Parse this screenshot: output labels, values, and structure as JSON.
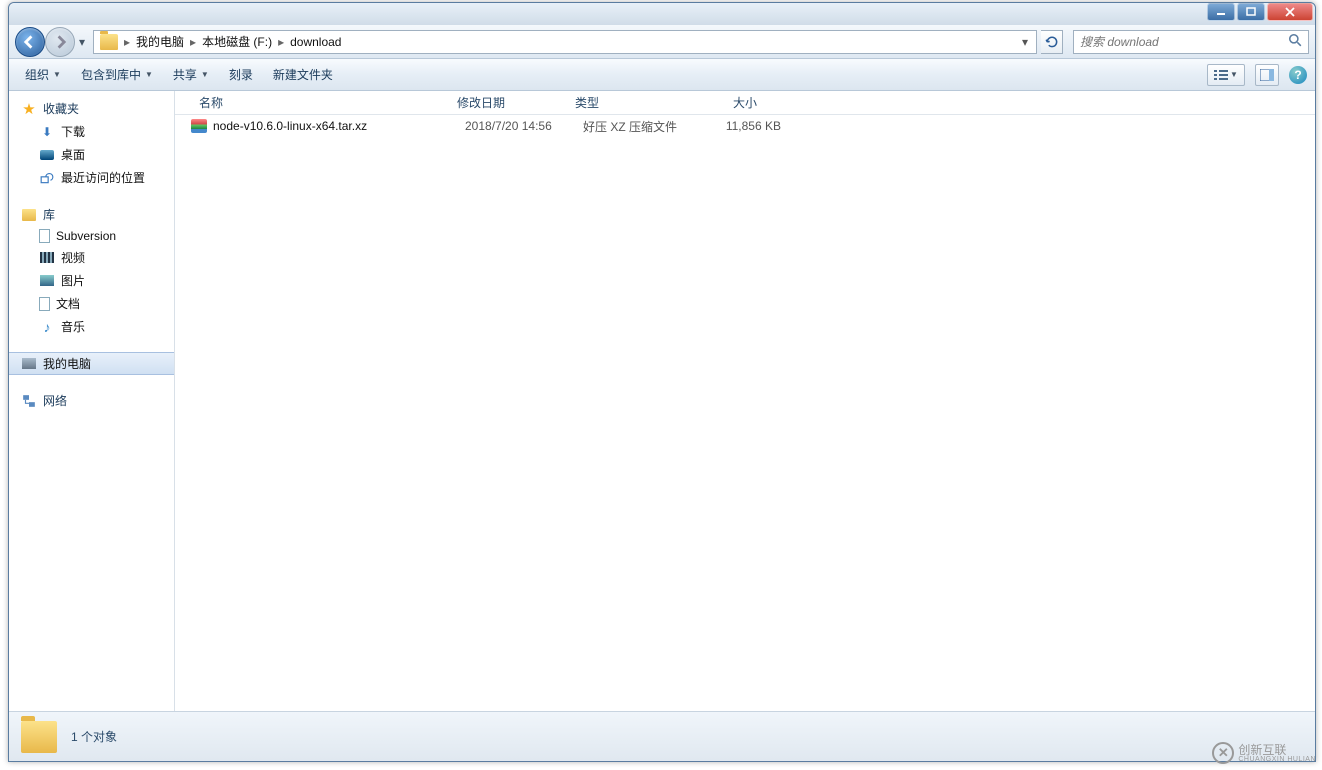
{
  "breadcrumb": {
    "root": "我的电脑",
    "drive": "本地磁盘 (F:)",
    "folder": "download"
  },
  "search": {
    "placeholder": "搜索 download"
  },
  "toolbar": {
    "organize": "组织",
    "include": "包含到库中",
    "share": "共享",
    "burn": "刻录",
    "new_folder": "新建文件夹"
  },
  "sidebar": {
    "favorites": {
      "label": "收藏夹",
      "items": [
        {
          "label": "下载"
        },
        {
          "label": "桌面"
        },
        {
          "label": "最近访问的位置"
        }
      ]
    },
    "library": {
      "label": "库",
      "items": [
        {
          "label": "Subversion"
        },
        {
          "label": "视频"
        },
        {
          "label": "图片"
        },
        {
          "label": "文档"
        },
        {
          "label": "音乐"
        }
      ]
    },
    "mycomputer": {
      "label": "我的电脑"
    },
    "network": {
      "label": "网络"
    }
  },
  "columns": {
    "name": "名称",
    "date": "修改日期",
    "type": "类型",
    "size": "大小"
  },
  "files": [
    {
      "name": "node-v10.6.0-linux-x64.tar.xz",
      "date": "2018/7/20 14:56",
      "type": "好压 XZ 压缩文件",
      "size": "11,856 KB"
    }
  ],
  "status": {
    "count_text": "1 个对象"
  },
  "watermark": {
    "brand": "创新互联",
    "sub": "CHUANGXIN HULIAN"
  }
}
